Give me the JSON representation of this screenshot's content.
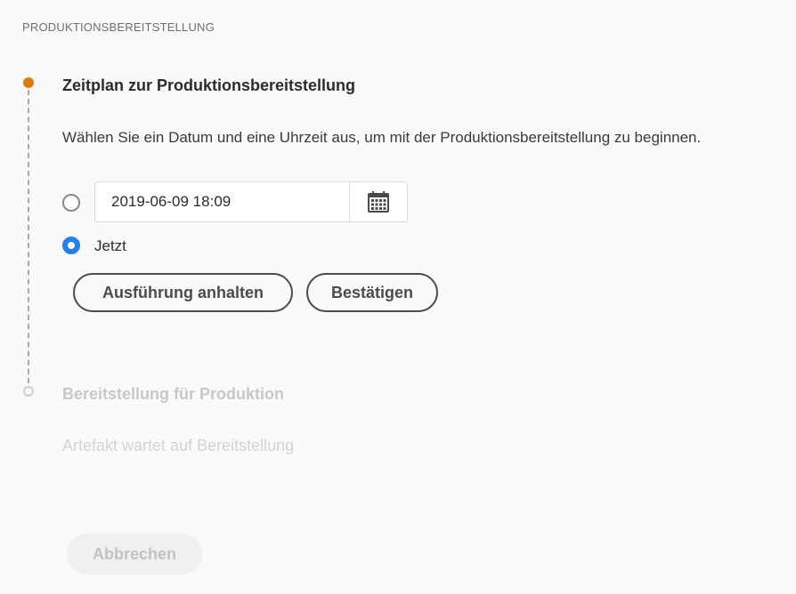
{
  "section": {
    "title": "PRODUKTIONSBEREITSTELLUNG"
  },
  "step1": {
    "title": "Zeitplan zur Produktionsbereitstellung",
    "description": "Wählen Sie ein Datum und eine Uhrzeit aus, um mit der Produktionsbereitstellung zu beginnen.",
    "schedule_option": {
      "datetime_value": "2019-06-09 18:09",
      "selected": false,
      "icon": "calendar-icon"
    },
    "now_option": {
      "label": "Jetzt",
      "selected": true
    },
    "pause_button_label": "Ausführung anhalten",
    "confirm_button_label": "Bestätigen"
  },
  "step2": {
    "title": "Bereitstellung für Produktion",
    "description": "Artefakt wartet auf Bereitstellung"
  },
  "footer": {
    "cancel_button_label": "Abbrechen"
  },
  "colors": {
    "active_step": "#e07a10",
    "radio_selected": "#2680eb"
  }
}
